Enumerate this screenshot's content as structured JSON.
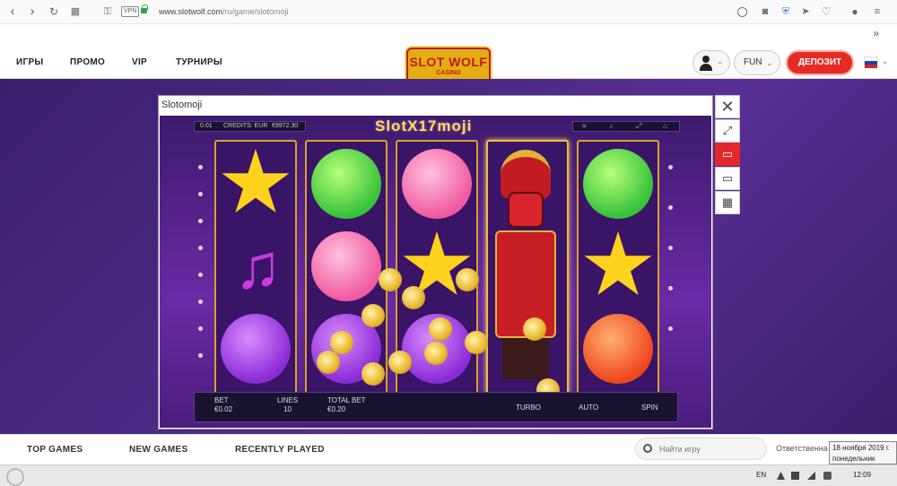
{
  "browser": {
    "url_domain": "www.slotwolf.com",
    "url_path": "/ru/game/slotomoji",
    "vpn_label": "VPN",
    "bookmarks_more": "»"
  },
  "site_nav": {
    "items": [
      "ИГРЫ",
      "ПРОМО",
      "VIP",
      "ТУРНИРЫ"
    ],
    "logo_line1": "SLOT WOLF",
    "logo_line2": "CASINO",
    "mode_label": "FUN",
    "deposit_label": "ДЕПОЗИТ"
  },
  "game": {
    "window_title": "Slotomoji",
    "logo_text": "SlotX17moji",
    "bet_step": "0.01",
    "credits_label": "CREDITS: EUR",
    "credits_value": "€9972.30",
    "bet_label": "BET",
    "bet_value": "€0.02",
    "lines_label": "LINES",
    "lines_value": "10",
    "total_bet_label": "TOTAL BET",
    "total_bet_value": "€0.20",
    "turbo_label": "TURBO",
    "auto_label": "AUTO",
    "spin_label": "SPIN"
  },
  "bottom_tabs": [
    "TOP GAMES",
    "NEW GAMES",
    "RECENTLY PLAYED"
  ],
  "search": {
    "placeholder": "Найти игру"
  },
  "responsible_text": "Ответственна",
  "tooltip": {
    "line1": "18 ноября 2019 г.",
    "line2": "понедельник"
  },
  "taskbar": {
    "lang": "EN",
    "time": "12:09"
  },
  "colors": {
    "accent_red": "#e42c24",
    "reel_gold": "#d8a22a",
    "stage_purple": "#4b2a86"
  }
}
